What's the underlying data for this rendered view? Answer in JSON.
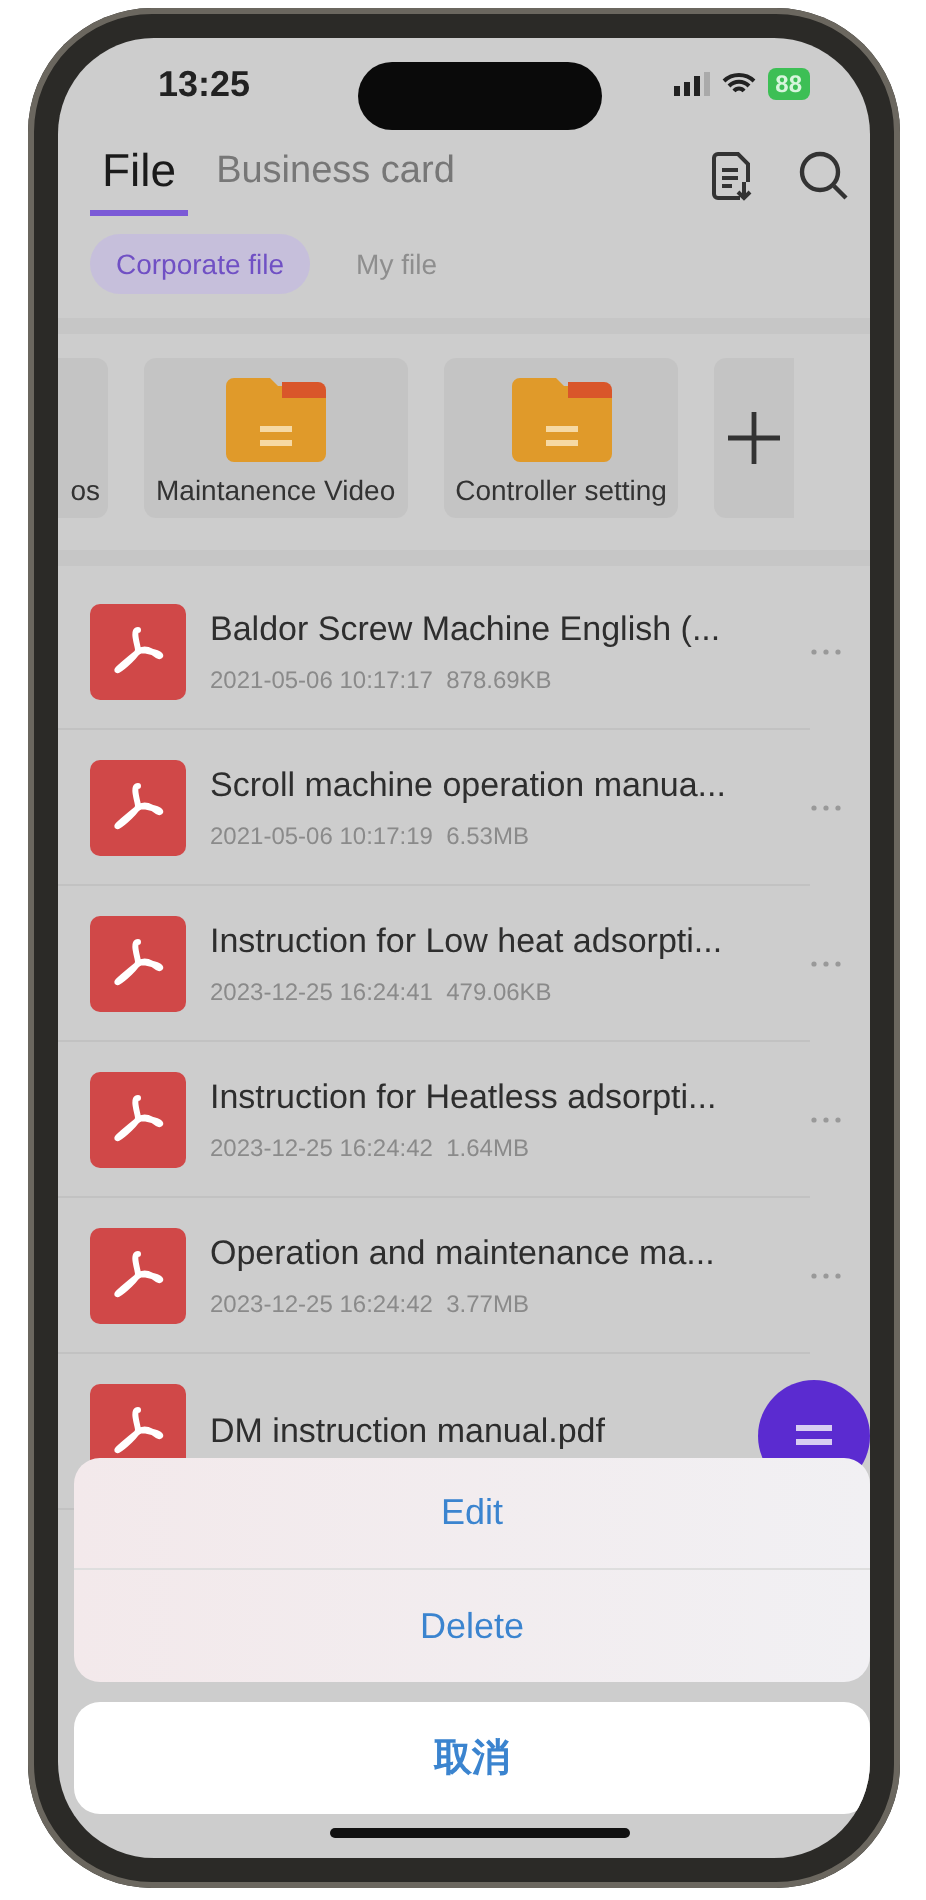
{
  "status_bar": {
    "time": "13:25",
    "battery": "88"
  },
  "tabs": [
    {
      "label": "File",
      "selected": true
    },
    {
      "label": "Business card",
      "selected": false
    }
  ],
  "chips": [
    {
      "label": "Corporate file",
      "selected": true
    },
    {
      "label": "My file",
      "selected": false
    }
  ],
  "folders": [
    {
      "kind": "partial",
      "label": "os"
    },
    {
      "kind": "folder",
      "label": "Maintanence Video"
    },
    {
      "kind": "folder",
      "label": "Controller setting"
    },
    {
      "kind": "add"
    }
  ],
  "files": [
    {
      "name": "Baldor Screw Machine English (...",
      "date": "2021-05-06 10:17:17",
      "size": "878.69KB"
    },
    {
      "name": "Scroll machine operation manua...",
      "date": "2021-05-06 10:17:19",
      "size": "6.53MB"
    },
    {
      "name": "Instruction for Low heat adsorpti...",
      "date": "2023-12-25 16:24:41",
      "size": "479.06KB"
    },
    {
      "name": "Instruction for Heatless adsorpti...",
      "date": "2023-12-25 16:24:42",
      "size": "1.64MB"
    },
    {
      "name": "Operation and maintenance ma...",
      "date": "2023-12-25 16:24:42",
      "size": "3.77MB"
    },
    {
      "name": "DM instruction manual.pdf"
    }
  ],
  "action_sheet": {
    "actions": [
      "Edit",
      "Delete"
    ],
    "cancel": "取消"
  }
}
